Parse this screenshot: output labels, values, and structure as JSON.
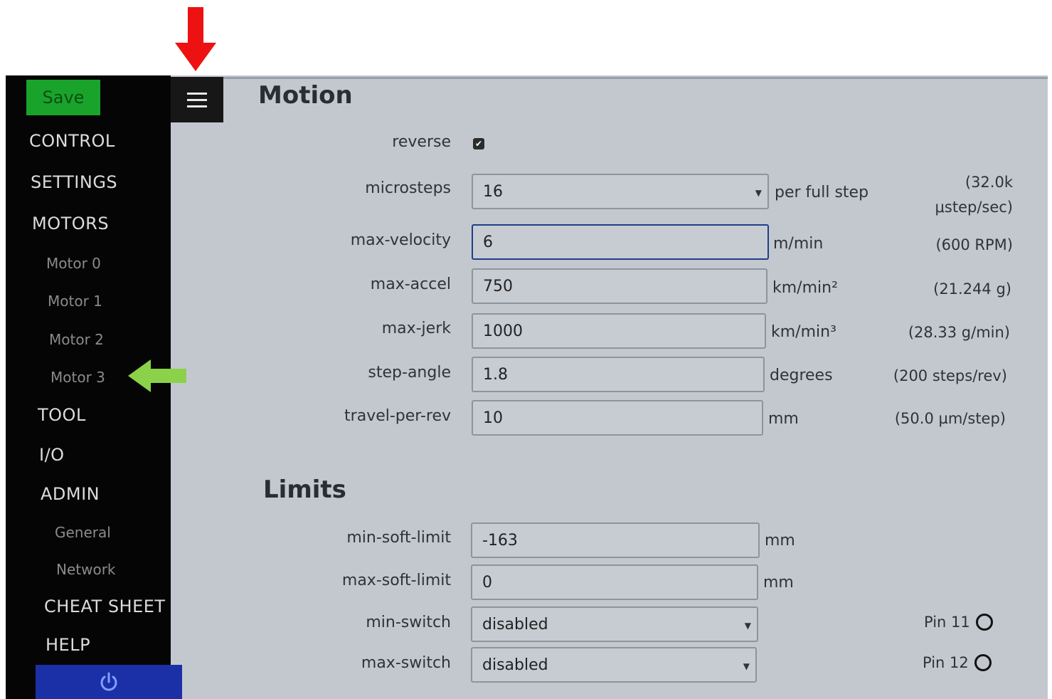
{
  "sidebar": {
    "save_label": "Save",
    "main_items": [
      "CONTROL",
      "SETTINGS",
      "MOTORS",
      "TOOL",
      "I/O",
      "ADMIN",
      "CHEAT SHEET",
      "HELP"
    ],
    "motor_items": [
      "Motor 0",
      "Motor 1",
      "Motor 2",
      "Motor 3"
    ],
    "admin_items": [
      "General",
      "Network"
    ],
    "power_icon": "power-icon"
  },
  "motion": {
    "title": "Motion",
    "reverse": {
      "label": "reverse",
      "checked": true
    },
    "microsteps": {
      "label": "microsteps",
      "value": "16",
      "unit": "per full step",
      "note_line1": "(32.0k",
      "note_line2": "μstep/sec)"
    },
    "max_velocity": {
      "label": "max-velocity",
      "value": "6",
      "unit": "m/min",
      "note": "(600 RPM)"
    },
    "max_accel": {
      "label": "max-accel",
      "value": "750",
      "unit": "km/min²",
      "note": "(21.244 g)"
    },
    "max_jerk": {
      "label": "max-jerk",
      "value": "1000",
      "unit": "km/min³",
      "note": "(28.33 g/min)"
    },
    "step_angle": {
      "label": "step-angle",
      "value": "1.8",
      "unit": "degrees",
      "note": "(200 steps/rev)"
    },
    "travel_per_rev": {
      "label": "travel-per-rev",
      "value": "10",
      "unit": "mm",
      "note": "(50.0 µm/step)"
    }
  },
  "limits": {
    "title": "Limits",
    "min_soft_limit": {
      "label": "min-soft-limit",
      "value": "-163",
      "unit": "mm"
    },
    "max_soft_limit": {
      "label": "max-soft-limit",
      "value": "0",
      "unit": "mm"
    },
    "min_switch": {
      "label": "min-switch",
      "value": "disabled",
      "pin": "Pin 11"
    },
    "max_switch": {
      "label": "max-switch",
      "value": "disabled",
      "pin": "Pin 12"
    }
  },
  "colors": {
    "annotation_red": "#ee1111",
    "annotation_blue": "#1010ee",
    "annotation_green": "#8bd24a",
    "save_green": "#1aa32b",
    "power_blue": "#1b2fa6"
  }
}
